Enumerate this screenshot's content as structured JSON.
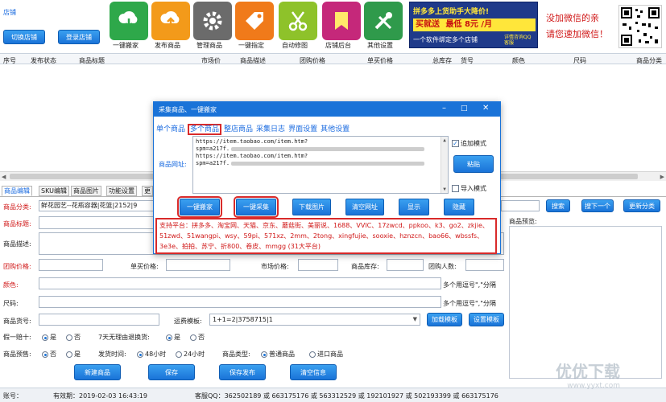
{
  "colors": {
    "accent": "#1a73d8",
    "link_blue": "#1a6be0",
    "red": "#d01818",
    "dialog_title_bg": "#1a73d8"
  },
  "topbar": {
    "shop_label": "店铺",
    "switch_shop": "切换店铺",
    "login_shop": "登录店铺",
    "tools": [
      {
        "label": "一键搬家",
        "icon": "cloud-download-icon",
        "color": "#2ea84a"
      },
      {
        "label": "发布商品",
        "icon": "cloud-upload-icon",
        "color": "#f39a1a"
      },
      {
        "label": "管理商品",
        "icon": "gear-icon",
        "color": "#6b6b6b"
      },
      {
        "label": "一键指定",
        "icon": "tag-icon",
        "color": "#f07a1a"
      },
      {
        "label": "自动修图",
        "icon": "scissors-icon",
        "color": "#8ec22a"
      },
      {
        "label": "店铺后台",
        "icon": "bookmark-icon",
        "color": "#c5287a"
      },
      {
        "label": "其他设置",
        "icon": "tools-icon",
        "color": "#2f9a4b"
      }
    ],
    "banner": {
      "headline": "拼多多上货助手大降价!",
      "price_prefix": "买就送",
      "price_low": "最低",
      "price_amount": "8元",
      "price_suffix": "/月",
      "sub": "一个软件绑定多个店铺",
      "note": "详情咨询QQ客服"
    },
    "wechat_line1": "没加微信的亲",
    "wechat_line2": "请您速加微信！"
  },
  "table_headers": [
    "序号",
    "发布状态",
    "商品标题",
    "市场价",
    "商品描述",
    "团购价格",
    "单买价格",
    "总库存",
    "货号",
    "颜色",
    "尺码",
    "商品分类"
  ],
  "tabs": [
    "商品编辑",
    "SKU编辑",
    "商品图片",
    "功能设置",
    "更"
  ],
  "form": {
    "category_label": "商品分类:",
    "category_value": "鲜花园艺--花瓶容器|花篮|2152|9",
    "title_label": "商品标题:",
    "desc_label": "商品描述:",
    "group_price_label": "团购价格:",
    "single_price_label": "单买价格:",
    "market_price_label": "市场价格:",
    "stock_label": "商品库存:",
    "group_people_label": "团购人数:",
    "color_label": "颜色:",
    "color_hint": "多个用逗号\",\"分隔",
    "size_label": "尺码:",
    "size_hint": "多个用逗号\",\"分隔",
    "sku_label": "商品货号:",
    "freight_label": "运费模板:",
    "freight_value": "1+1=2|3758715|1",
    "load_template": "加载模板",
    "set_template": "设置模板",
    "fake_label": "假一赔十:",
    "fake_yes": "是",
    "fake_no": "否",
    "seven_day_label": "7天无理由退换货:",
    "seven_yes": "是",
    "seven_no": "否",
    "prerelease_label": "商品预售:",
    "pre_yes": "是",
    "pre_no": "否",
    "ship_time_label": "发货时间:",
    "ship_48": "48小时",
    "ship_24": "24小时",
    "product_type_label": "商品类型:",
    "type_normal": "普通商品",
    "type_import": "进口商品",
    "preview_label": "商品预览:",
    "search": "搜索",
    "search_next": "搜下一个",
    "update_category": "更新分类",
    "new_product": "新建商品",
    "save": "保存",
    "save_publish": "保存发布",
    "clear_info": "清空信息"
  },
  "dialog": {
    "title": "采集商品、一键搬家",
    "menu": [
      "单个商品",
      "多个商品",
      "整店商品",
      "采集日志",
      "界面设置",
      "其他设置"
    ],
    "url_label": "商品网址:",
    "urls": [
      "https://item.taobao.com/item.htm?",
      "spm=a217f.",
      "https://item.taobao.com/item.htm?",
      "spm=a217f."
    ],
    "append_mode": "追加模式",
    "paste": "粘贴",
    "import_mode": "导入模式",
    "buttons": [
      "一键搬家",
      "一键采集",
      "下载图片",
      "清空网址",
      "显示",
      "隐藏"
    ],
    "platforms": "支持平台：拼多多、淘宝网、天猫、京东、蘑菇街、美丽说、1688、VVIC、17zwcd、ppkoo、k3、go2、zkjie、51zwd、51wangpi、wsy、59pi、571xz、2mm、2tong、xingfujie、sooxie、hznzcn、bao66、wbssfs、3e3e、拍拍、苏宁、折800、卷皮、mmgg (31大平台)"
  },
  "status": {
    "account": "账号：",
    "expiry": "有效期：2019-02-03 16:43:19",
    "qq": "客服QQ：362502189 或 663175176 或 563312529 或 192101927 或 502193399 或 663175176"
  },
  "watermark": {
    "text": "优优下载",
    "url": "www.yyxt.com"
  }
}
